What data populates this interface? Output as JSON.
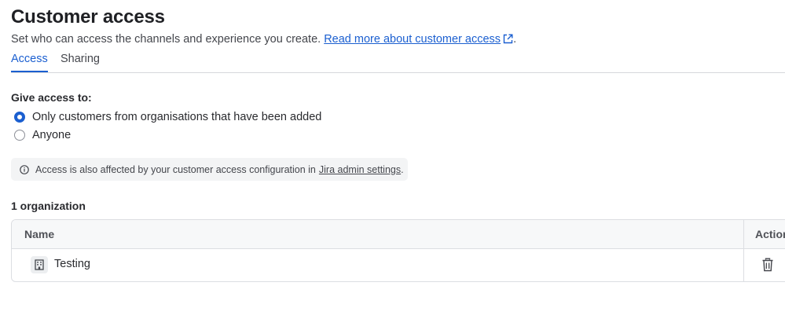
{
  "header": {
    "title": "Customer access",
    "subtitle": "Set who can access the channels and experience you create.",
    "read_more_link": "Read more about customer access",
    "subtitle_end": "."
  },
  "tabs": [
    {
      "label": "Access",
      "active": true
    },
    {
      "label": "Sharing",
      "active": false
    }
  ],
  "access": {
    "label": "Give access to:",
    "options": [
      {
        "label": "Only customers from organisations that have been added",
        "selected": true
      },
      {
        "label": "Anyone",
        "selected": false
      }
    ]
  },
  "info": {
    "text": "Access is also affected by your customer access configuration in",
    "link": "Jira admin settings",
    "end": "."
  },
  "organizations": {
    "count_label": "1 organization",
    "columns": [
      "Name",
      "Actions"
    ],
    "rows": [
      {
        "name": "Testing",
        "icon": "building-icon"
      }
    ]
  },
  "colors": {
    "accent": "#1b5fd0",
    "text": "#292a2e",
    "muted": "#44464c"
  }
}
